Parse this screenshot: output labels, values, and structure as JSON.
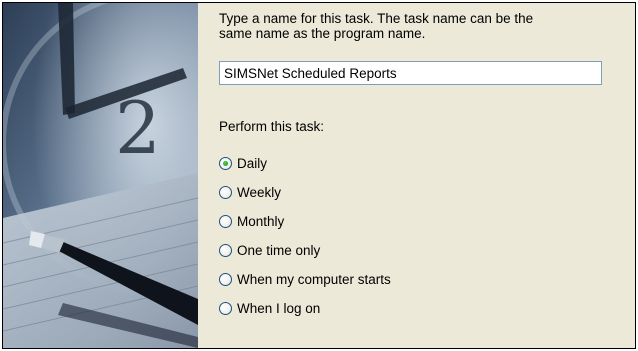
{
  "task_name": {
    "prompt": "Type a name for this task.  The task name can be the same name as the program name.",
    "value": "SIMSNet Scheduled Reports"
  },
  "schedule": {
    "label": "Perform this task:",
    "options": [
      {
        "label": "Daily",
        "checked": true
      },
      {
        "label": "Weekly",
        "checked": false
      },
      {
        "label": "Monthly",
        "checked": false
      },
      {
        "label": "One time only",
        "checked": false
      },
      {
        "label": "When my computer starts",
        "checked": false
      },
      {
        "label": "When I log on",
        "checked": false
      }
    ]
  },
  "colors": {
    "dialog_bg": "#ece9d8",
    "radio_dot": "#21a121",
    "input_border": "#7f9db9"
  },
  "icons": [
    "clock-and-pen-wizard-art"
  ]
}
